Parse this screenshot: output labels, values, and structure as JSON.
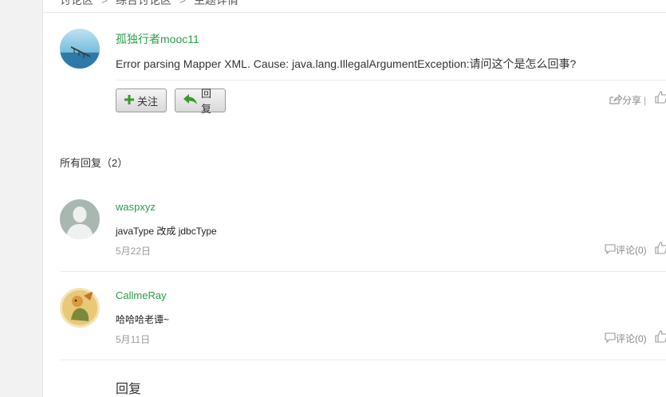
{
  "breadcrumb": {
    "items": [
      "讨论区",
      "综合讨论区",
      "主题详情"
    ],
    "separator": ">"
  },
  "question": {
    "author": "孤独行者mooc11",
    "text": "Error parsing Mapper XML. Cause: java.lang.IllegalArgumentException:请问这个是怎么回事?",
    "follow_label": "关注",
    "reply_label": "回复",
    "share_label": "分享",
    "share_sep": "|"
  },
  "replies_header": "所有回复（2）",
  "replies": [
    {
      "author": "waspxyz",
      "text": "javaType 改成 jdbcType",
      "date": "5月22日",
      "comment_label": "评论(0)"
    },
    {
      "author": "CallmeRay",
      "text": "哈哈哈老谭~",
      "date": "5月11日",
      "comment_label": "评论(0)"
    }
  ],
  "reply_heading": "回复",
  "colors": {
    "accent_green": "#2a9d4a",
    "text": "#333333",
    "muted": "#999999"
  }
}
